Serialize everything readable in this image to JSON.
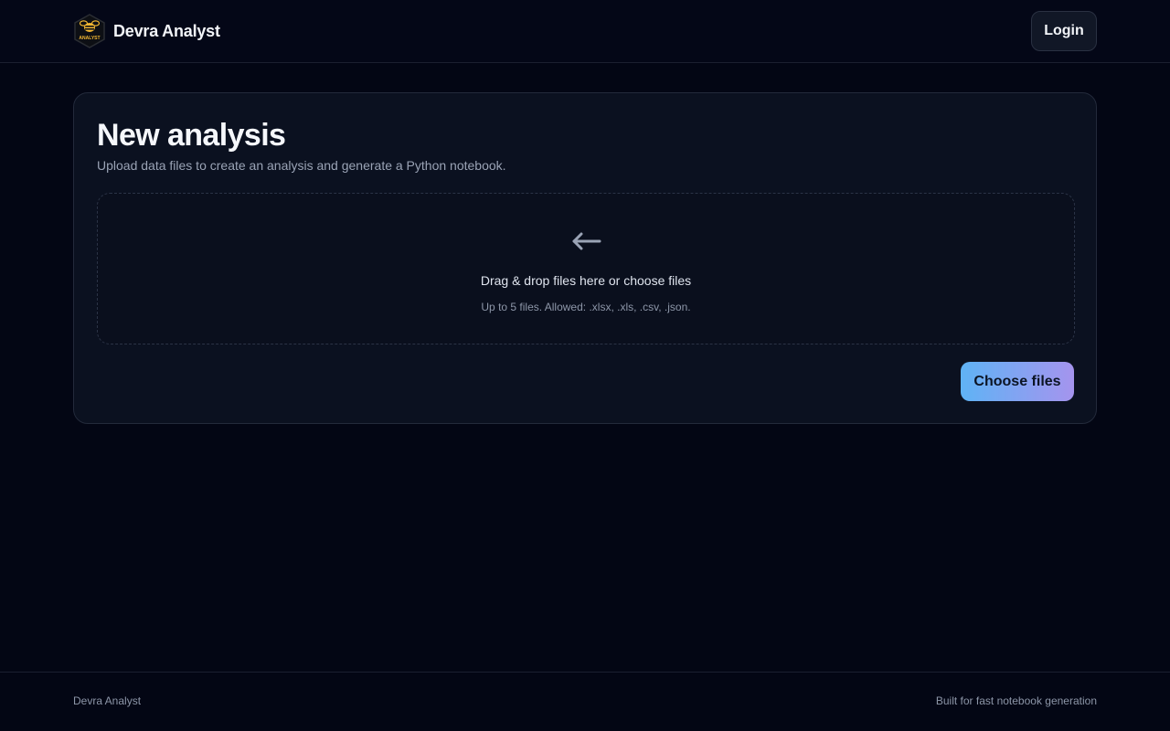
{
  "header": {
    "brand_name": "Devra Analyst",
    "logo_text": "ANALYST",
    "logo_icon": "bee-icon",
    "login_label": "Login"
  },
  "card": {
    "title": "New analysis",
    "subtitle": "Upload data files to create an analysis and generate a Python notebook.",
    "dropzone": {
      "icon": "arrow-left-icon",
      "main_text": "Drag & drop files here or choose files",
      "hint_text": "Up to 5 files. Allowed: .xlsx, .xls, .csv, .json."
    },
    "choose_files_label": "Choose files"
  },
  "footer": {
    "left_text": "Devra Analyst",
    "right_text": "Built for fast notebook generation"
  },
  "colors": {
    "background": "#030614",
    "card_background": "#0b1120",
    "accent_gradient_start": "#5fb3f5",
    "accent_gradient_end": "#a594ee",
    "logo_gold": "#f2b733"
  }
}
